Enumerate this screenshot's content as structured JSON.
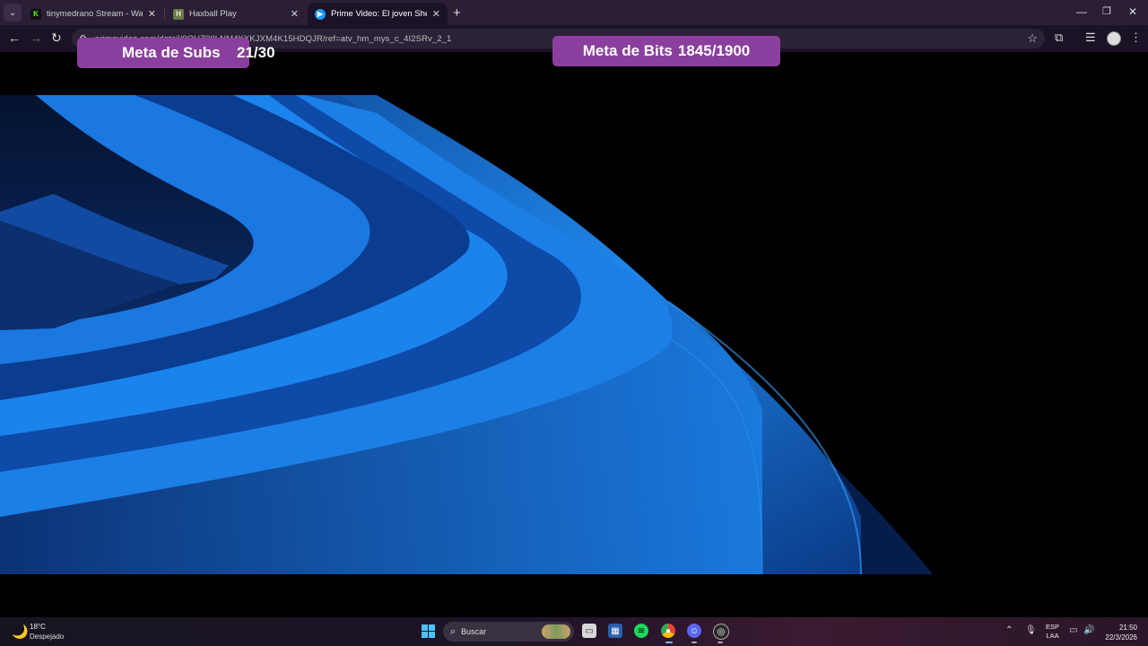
{
  "browser": {
    "tabs": [
      {
        "title": "tinymedrano Stream - Watch Li",
        "favicon": "kick-icon",
        "active": false
      },
      {
        "title": "Haxball Play",
        "favicon": "haxball-icon",
        "active": false
      },
      {
        "title": "Prime Video: El joven Sherlock",
        "favicon": "prime-video-icon",
        "active": true
      }
    ],
    "url": "primevideo.com/detail/0OHZ.../ref=atv_hm_mys_c_4l2SRv_2_1",
    "url_visible": "primevideo.com/detail/0QHZ00LNM4KXKJXM4K15HDQJR/ref=atv_hm_mys_c_4I2SRv_2_1"
  },
  "overlays": {
    "subs_label": "Meta de Subs",
    "subs_value": "21/30",
    "bits_label": "Meta de Bits",
    "bits_value": "1845/1900"
  },
  "taskbar": {
    "weather_temp": "18°C",
    "weather_desc": "Despejado",
    "search_placeholder": "Buscar",
    "lang_1": "ESP",
    "lang_2": "LAA",
    "time": "21:50",
    "date": "22/3/2026",
    "apps": [
      "file-explorer-icon",
      "store-icon",
      "spotify-icon",
      "chrome-icon",
      "discord-icon",
      "obs-icon"
    ]
  },
  "colors": {
    "overlay_purple": "#8a3f9e",
    "wallpaper_blue": "#1a78e0",
    "browser_frame": "#2a1f36"
  }
}
